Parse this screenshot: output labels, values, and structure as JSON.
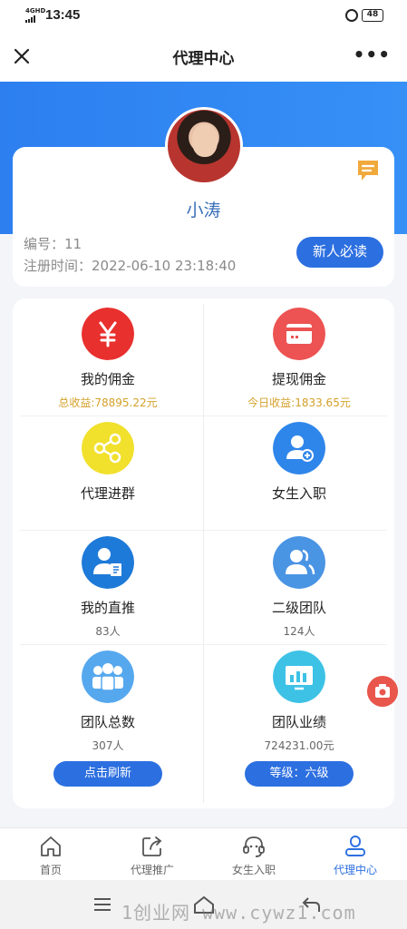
{
  "status_bar": {
    "network": "4GHD",
    "time": "13:45",
    "battery": "48"
  },
  "nav": {
    "title": "代理中心"
  },
  "profile": {
    "name": "小涛",
    "id_label": "编号：",
    "id_value": "11",
    "register_label": "注册时间：",
    "register_value": "2022-06-10 23:18:40",
    "guide_button": "新人必读"
  },
  "grid": [
    {
      "label": "我的佣金",
      "sub": "总收益:78895.22元",
      "icon": "yen-icon",
      "color": "#e8302e"
    },
    {
      "label": "提现佣金",
      "sub": "今日收益:1833.65元",
      "icon": "card-icon",
      "color": "#ec5352"
    },
    {
      "label": "代理进群",
      "sub": "",
      "icon": "share-icon",
      "color": "#f1e02c"
    },
    {
      "label": "女生入职",
      "sub": "",
      "icon": "add-user-icon",
      "color": "#2f86ea"
    },
    {
      "label": "我的直推",
      "sub": "83人",
      "icon": "user-doc-icon",
      "color": "#1e7ad8"
    },
    {
      "label": "二级团队",
      "sub": "124人",
      "icon": "users-icon",
      "color": "#4a94e4"
    },
    {
      "label": "团队总数",
      "sub": "307人",
      "icon": "team-icon",
      "color": "#56a8ee"
    },
    {
      "label": "团队业绩",
      "sub": "724231.00元",
      "icon": "chart-screen-icon",
      "color": "#3dc2e6"
    }
  ],
  "buttons": {
    "refresh": "点击刷新",
    "level": "等级：六级"
  },
  "tabs": [
    {
      "label": "首页",
      "icon": "home-icon"
    },
    {
      "label": "代理推广",
      "icon": "share-box-icon"
    },
    {
      "label": "女生入职",
      "icon": "headset-icon"
    },
    {
      "label": "代理中心",
      "icon": "person-icon",
      "active": true
    }
  ],
  "watermark": "1创业网 www.cywz1.com",
  "accent": "#2c6fe0"
}
